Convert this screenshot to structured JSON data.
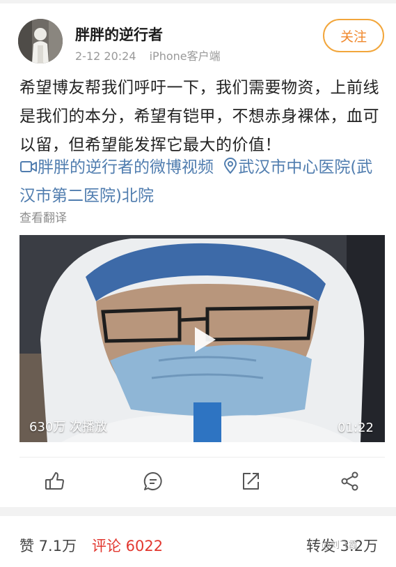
{
  "author": {
    "name": "胖胖的逆行者",
    "time": "2-12 20:24",
    "client": "iPhone客户端",
    "follow_label": "关注"
  },
  "post": {
    "text": "希望博友帮我们呼吁一下，我们需要物资，上前线是我们的本分，希望有铠甲，不想赤身裸体，血可以留，但希望能发挥它最大的价值！",
    "video_link": "胖胖的逆行者的微博视频",
    "location_link": "武汉市中心医院(武汉市第二医院)北院",
    "translate_label": "查看翻译"
  },
  "video": {
    "views": "630万 次播放",
    "duration": "01:22"
  },
  "actions": {
    "like_icon": "thumb-up-icon",
    "comment_icon": "comment-icon",
    "repost_icon": "repost-icon",
    "share_icon": "share-icon"
  },
  "stats": {
    "likes": "赞 7.1万",
    "comments": "评论 6022",
    "reposts": "转发 3.2万"
  },
  "watermark": "@刘飞霞",
  "colors": {
    "accent_orange": "#f0882c",
    "link_blue": "#507daf",
    "comment_red": "#e2372f"
  }
}
